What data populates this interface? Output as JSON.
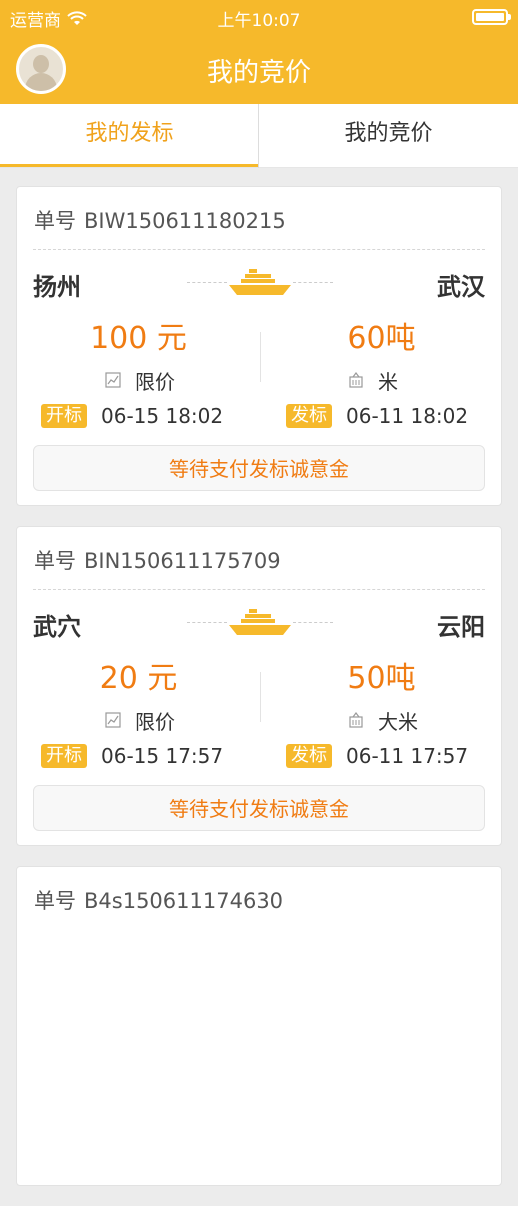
{
  "status_bar": {
    "carrier": "运营商",
    "time": "上午10:07"
  },
  "nav": {
    "title": "我的竞价"
  },
  "tabs": [
    {
      "label": "我的发标",
      "active": true
    },
    {
      "label": "我的竞价",
      "active": false
    }
  ],
  "order_label": "单号",
  "tag_open": "开标",
  "tag_publish": "发标",
  "pay_label": "等待支付发标诚意金",
  "colors": {
    "brand": "#f6b92b",
    "accent": "#f07c13"
  },
  "icons": {
    "price_type": "chart-icon",
    "goods": "container-icon",
    "transport": "ship-icon"
  },
  "orders": [
    {
      "no": "BIW150611180215",
      "from": "扬州",
      "to": "武汉",
      "price": "100 元",
      "price_type": "限价",
      "quantity": "60吨",
      "goods": "米",
      "open_time": "06-15 18:02",
      "publish_time": "06-11 18:02"
    },
    {
      "no": "BIN150611175709",
      "from": "武穴",
      "to": "云阳",
      "price": "20 元",
      "price_type": "限价",
      "quantity": "50吨",
      "goods": "大米",
      "open_time": "06-15 17:57",
      "publish_time": "06-11 17:57"
    },
    {
      "no": "B4s150611174630"
    }
  ]
}
